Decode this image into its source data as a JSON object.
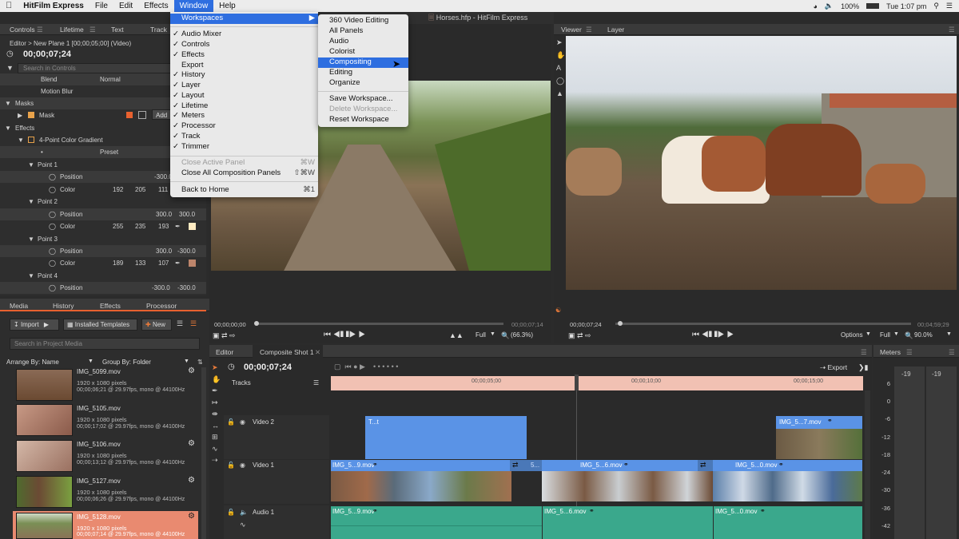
{
  "menubar": {
    "app": "HitFilm Express",
    "items": [
      "File",
      "Edit",
      "Effects",
      "Window",
      "Help"
    ],
    "selected": "Window",
    "battery": "100%",
    "clock": "Tue 1:07 pm"
  },
  "window_title": "Horses.hfp - HitFilm Express",
  "controls_panel": {
    "tabs": [
      "Controls",
      "Lifetime",
      "Text",
      "Track"
    ],
    "path": "Editor > New Plane 1 [00;00;05;00] (Video)",
    "timecode": "00;00;07;24",
    "search_placeholder": "Search in Controls",
    "rows": {
      "blend": "Blend",
      "blend_value": "Normal",
      "motion_blur": "Motion Blur",
      "masks": "Masks",
      "mask": "Mask",
      "add": "Add",
      "effects": "Effects",
      "effect_name": "4-Point Color Gradient",
      "preset": "Preset",
      "point1": "Point 1",
      "p1_pos_x": "-300.0",
      "p1_color": [
        "192",
        "205",
        "111"
      ],
      "point2": "Point 2",
      "p2_pos": [
        "300.0",
        "300.0"
      ],
      "p2_color": [
        "255",
        "235",
        "193"
      ],
      "point3": "Point 3",
      "p3_pos": [
        "300.0",
        "-300.0"
      ],
      "p3_color": [
        "189",
        "133",
        "107"
      ],
      "point4": "Point 4",
      "p4_pos": [
        "-300.0",
        "-300.0"
      ],
      "position": "Position",
      "color": "Color"
    }
  },
  "window_menu": {
    "workspaces": "Workspaces",
    "items": [
      {
        "label": "Audio Mixer",
        "checked": true
      },
      {
        "label": "Controls",
        "checked": true
      },
      {
        "label": "Effects",
        "checked": true
      },
      {
        "label": "Export",
        "checked": false
      },
      {
        "label": "History",
        "checked": true
      },
      {
        "label": "Layer",
        "checked": true
      },
      {
        "label": "Layout",
        "checked": true
      },
      {
        "label": "Lifetime",
        "checked": true
      },
      {
        "label": "Meters",
        "checked": true
      },
      {
        "label": "Processor",
        "checked": true
      },
      {
        "label": "Track",
        "checked": true
      },
      {
        "label": "Trimmer",
        "checked": true
      }
    ],
    "close_active": "Close Active Panel",
    "close_active_sc": "⌘W",
    "close_all": "Close All Composition Panels",
    "close_all_sc": "⇧⌘W",
    "back_home": "Back to Home",
    "back_home_sc": "⌘1"
  },
  "workspaces_submenu": {
    "items": [
      "360 Video Editing",
      "All Panels",
      "Audio",
      "Colorist",
      "Compositing",
      "Editing",
      "Organize"
    ],
    "highlighted": "Compositing",
    "save": "Save Workspace...",
    "delete": "Delete Workspace...",
    "reset": "Reset Workspace"
  },
  "trimmer": {
    "start": "00;00;00;00",
    "end": "00;00;07;14",
    "full": "Full",
    "zoom": "(66.3%)"
  },
  "viewer": {
    "tabs": [
      "Viewer",
      "Layer"
    ],
    "timecode": "00;00;07;24",
    "end": "00;04;59;29",
    "options": "Options",
    "full": "Full",
    "zoom": "90.0%"
  },
  "media_panel": {
    "tabs": [
      "Media",
      "History",
      "Effects",
      "Processor"
    ],
    "import": "Import",
    "installed": "Installed Templates",
    "new": "New",
    "search_placeholder": "Search in Project Media",
    "arrange": "Arrange By: Name",
    "group": "Group By: Folder",
    "items": [
      {
        "name": "IMG_5099.mov",
        "dims": "1920 x 1080 pixels",
        "info": "00;00;06;21 @ 29.97fps, mono @ 44100Hz"
      },
      {
        "name": "IMG_5105.mov",
        "dims": "1920 x 1080 pixels",
        "info": "00;00;17;02 @ 29.97fps, mono @ 44100Hz"
      },
      {
        "name": "IMG_5106.mov",
        "dims": "1920 x 1080 pixels",
        "info": "00;00;13;12 @ 29.97fps, mono @ 44100Hz"
      },
      {
        "name": "IMG_5127.mov",
        "dims": "1920 x 1080 pixels",
        "info": "00;00;06;26 @ 29.97fps, mono @ 44100Hz"
      },
      {
        "name": "IMG_5128.mov",
        "dims": "1920 x 1080 pixels",
        "info": "00;00;07;14 @ 29.97fps, mono @ 44100Hz"
      }
    ]
  },
  "editor": {
    "tabs": [
      "Editor",
      "Composite Shot 1"
    ],
    "timecode": "00;00;07;24",
    "export": "Export",
    "tracks_label": "Tracks",
    "ruler": [
      "00;00;05;00",
      "00;00;10;00",
      "00;00;15;00"
    ],
    "tracks": [
      "Video 2",
      "Video 1",
      "Audio 1"
    ],
    "v2_clips": [
      "T...t",
      "IMG_5...7.mov"
    ],
    "v1_clips": [
      "IMG_5...9.mov",
      "5...",
      "IMG_5...6.mov",
      "IMG_5...0.mov"
    ],
    "a1_clips": [
      "IMG_5...9.mov",
      "IMG_5...6.mov",
      "IMG_5...0.mov"
    ]
  },
  "meters": {
    "title": "Meters",
    "peaks": [
      "-19",
      "-19"
    ],
    "scale": [
      "6",
      "0",
      "-6",
      "-12",
      "-18",
      "-24",
      "-30",
      "-36",
      "-42"
    ]
  },
  "colors": {
    "menu_highlight": "#2e6ee0",
    "clip_blue": "#5a93e6",
    "audio_teal": "#3aa88c",
    "ruler_pink": "#f1c1b3",
    "selected_media": "#e98a70"
  }
}
